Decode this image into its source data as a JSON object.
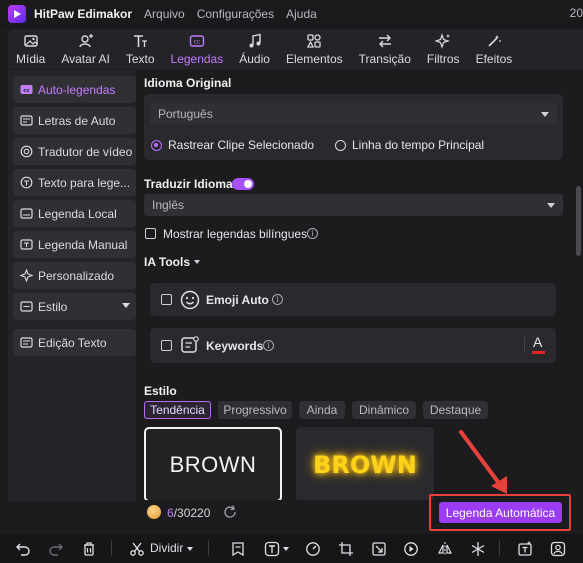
{
  "app": {
    "name": "HitPaw Edimakor",
    "menu": [
      "Arquivo",
      "Configurações",
      "Ajuda"
    ],
    "clock_fragment": "20"
  },
  "tabs": [
    {
      "label": "Mídia",
      "icon": "image-icon"
    },
    {
      "label": "Avatar AI",
      "icon": "avatar-plus-icon"
    },
    {
      "label": "Texto",
      "icon": "text-icon"
    },
    {
      "label": "Legendas",
      "icon": "captions-icon",
      "active": true
    },
    {
      "label": "Áudio",
      "icon": "music-note-icon"
    },
    {
      "label": "Elementos",
      "icon": "elements-icon"
    },
    {
      "label": "Transição",
      "icon": "transition-arrows-icon"
    },
    {
      "label": "Filtros",
      "icon": "sparkle-icon"
    },
    {
      "label": "Efeitos",
      "icon": "magic-wand-icon"
    }
  ],
  "sidebar": {
    "items": [
      {
        "label": "Auto-legendas",
        "icon": "cc-icon",
        "active": true
      },
      {
        "label": "Letras de Auto",
        "icon": "lyrics-icon"
      },
      {
        "label": "Tradutor de vídeo",
        "icon": "translate-icon"
      },
      {
        "label": "Texto para lege...",
        "icon": "text-to-caption-icon"
      },
      {
        "label": "Legenda Local",
        "icon": "local-caption-icon"
      },
      {
        "label": "Legenda Manual",
        "icon": "manual-caption-icon"
      },
      {
        "label": "Personalizado",
        "icon": "custom-icon"
      },
      {
        "label": "Estilo",
        "icon": "style-icon",
        "has_dropdown": true
      },
      {
        "label": "Edição Texto",
        "icon": "edit-text-icon"
      }
    ]
  },
  "main": {
    "original_language": {
      "title": "Idioma Original",
      "selected": "Português",
      "options": [
        {
          "label": "Rastrear Clipe Selecionado",
          "selected": true
        },
        {
          "label": "Linha do tempo Principal",
          "selected": false
        }
      ]
    },
    "translate": {
      "title": "Traduzir Idioma",
      "enabled": true,
      "selected": "Inglês",
      "bilingual_label": "Mostrar legendas bilíngues"
    },
    "ia_tools": {
      "title": "IA Tools",
      "tools": [
        {
          "label": "Emoji Auto",
          "icon": "smiley-icon"
        },
        {
          "label": "Keywords",
          "icon": "keywords-icon",
          "extra": "A"
        }
      ]
    },
    "style": {
      "title": "Estilo",
      "tabs": [
        "Tendência",
        "Progressivo",
        "Ainda",
        "Dinâmico",
        "Destaque"
      ],
      "active_tab": "Tendência",
      "previews": [
        "BROWN",
        "BROWN"
      ]
    },
    "credits": {
      "used": "6",
      "total": "/30220"
    },
    "auto_caption_button": "Legenda Automática"
  },
  "toolbar": {
    "split_label": "Dividir"
  },
  "colors": {
    "accent": "#a650f5",
    "highlight_box": "#e8413c",
    "arrow": "#e8413c",
    "glow_text": "#ffd21a"
  }
}
